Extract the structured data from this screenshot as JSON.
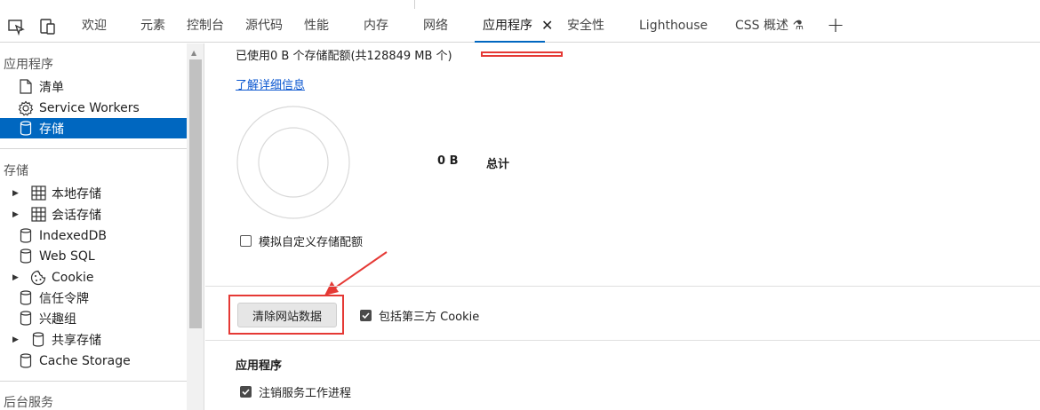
{
  "tabs": [
    {
      "label": "欢迎"
    },
    {
      "label": "元素"
    },
    {
      "label": "控制台"
    },
    {
      "label": "源代码"
    },
    {
      "label": "性能"
    },
    {
      "label": "内存"
    },
    {
      "label": "网络"
    },
    {
      "label": "应用程序",
      "active": true
    },
    {
      "label": "安全性"
    },
    {
      "label": "Lighthouse"
    },
    {
      "label": "CSS 概述 ⚗"
    }
  ],
  "sidebar": {
    "application_section": "应用程序",
    "application_items": [
      {
        "label": "清单",
        "icon": "file-icon"
      },
      {
        "label": "Service Workers",
        "icon": "gear-icon"
      },
      {
        "label": "存储",
        "icon": "database-icon",
        "selected": true
      }
    ],
    "storage_section": "存储",
    "storage_items": [
      {
        "label": "本地存储",
        "icon": "grid-icon",
        "expandable": true
      },
      {
        "label": "会话存储",
        "icon": "grid-icon",
        "expandable": true
      },
      {
        "label": "IndexedDB",
        "icon": "database-icon"
      },
      {
        "label": "Web SQL",
        "icon": "database-icon"
      },
      {
        "label": "Cookie",
        "icon": "cookie-icon",
        "expandable": true
      },
      {
        "label": "信任令牌",
        "icon": "database-icon"
      },
      {
        "label": "兴趣组",
        "icon": "database-icon"
      },
      {
        "label": "共享存储",
        "icon": "database-icon",
        "expandable": true
      },
      {
        "label": "Cache Storage",
        "icon": "database-icon"
      }
    ],
    "background_section": "后台服务"
  },
  "main": {
    "usage_text": "已使用0 B 个存储配额(共128849 MB 个)",
    "learn_more": "了解详细信息",
    "total_value": "0 B",
    "total_label": "总计",
    "simulate_quota_label": "模拟自定义存储配额",
    "simulate_quota_checked": false,
    "clear_button": "清除网站数据",
    "include_third_party_label": "包括第三方 Cookie",
    "include_third_party_checked": true,
    "application_section_title": "应用程序",
    "unregister_sw_label": "注销服务工作进程",
    "unregister_sw_checked": true
  },
  "colors": {
    "accent": "#0067c0",
    "annotation_red": "#e53935",
    "link": "#0b57d0"
  }
}
